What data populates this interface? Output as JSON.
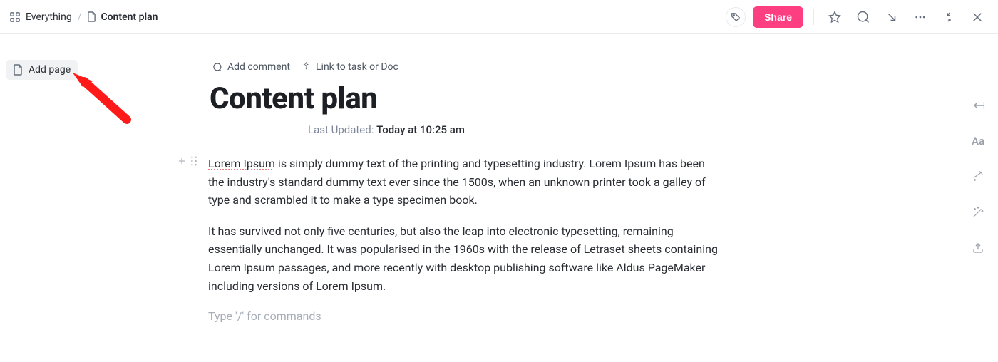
{
  "breadcrumb": {
    "root": "Everything",
    "separator": "/",
    "page": "Content plan"
  },
  "topbar": {
    "share": "Share"
  },
  "sidebar": {
    "add_page": "Add page"
  },
  "doc": {
    "toolbar": {
      "add_comment": "Add comment",
      "link_task": "Link to task or Doc"
    },
    "title": "Content plan",
    "meta": {
      "label": "Last Updated:",
      "value": "Today at 10:25 am"
    },
    "para1_spell": "Lorem Ipsum",
    "para1_rest": " is simply dummy text of the printing and typesetting industry. Lorem Ipsum has been the industry's standard dummy text ever since the 1500s, when an unknown printer took a galley of type and scrambled it to make a type specimen book.",
    "para2": "It has survived not only five centuries, but also the leap into electronic typesetting, remaining essentially unchanged. It was popularised in the 1960s with the release of Letraset sheets containing Lorem Ipsum passages, and more recently with desktop publishing software like Aldus PageMaker including versions of Lorem Ipsum.",
    "placeholder": "Type '/' for commands"
  },
  "rightrail": {
    "typography": "Aa"
  }
}
